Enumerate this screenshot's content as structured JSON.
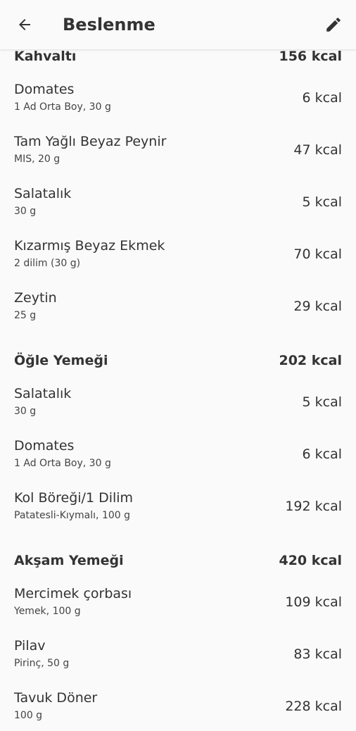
{
  "header": {
    "title": "Beslenme",
    "back_icon": "arrow-left-icon",
    "edit_icon": "pencil-icon"
  },
  "sections": [
    {
      "name": "Kahvaltı",
      "kcal": "156 kcal",
      "items": [
        {
          "name": "Domates",
          "desc": "1 Ad Orta Boy, 30 g",
          "kcal": "6 kcal"
        },
        {
          "name": "Tam Yağlı Beyaz Peynir",
          "desc": "MIS, 20 g",
          "kcal": "47 kcal"
        },
        {
          "name": "Salatalık",
          "desc": "30 g",
          "kcal": "5 kcal"
        },
        {
          "name": "Kızarmış Beyaz Ekmek",
          "desc": "2 dilim (30 g)",
          "kcal": "70 kcal"
        },
        {
          "name": "Zeytin",
          "desc": "25 g",
          "kcal": "29 kcal"
        }
      ]
    },
    {
      "name": "Öğle Yemeği",
      "kcal": "202 kcal",
      "items": [
        {
          "name": "Salatalık",
          "desc": "30 g",
          "kcal": "5 kcal"
        },
        {
          "name": "Domates",
          "desc": "1 Ad Orta Boy, 30 g",
          "kcal": "6 kcal"
        },
        {
          "name": "Kol Böreği/1 Dilim",
          "desc": "Patatesli-Kıymalı, 100 g",
          "kcal": "192 kcal"
        }
      ]
    },
    {
      "name": "Akşam Yemeği",
      "kcal": "420 kcal",
      "items": [
        {
          "name": "Mercimek çorbası",
          "desc": "Yemek, 100 g",
          "kcal": "109 kcal"
        },
        {
          "name": "Pilav",
          "desc": "Pirinç, 50 g",
          "kcal": "83 kcal"
        },
        {
          "name": "Tavuk Döner",
          "desc": "100 g",
          "kcal": "228 kcal"
        }
      ]
    }
  ]
}
